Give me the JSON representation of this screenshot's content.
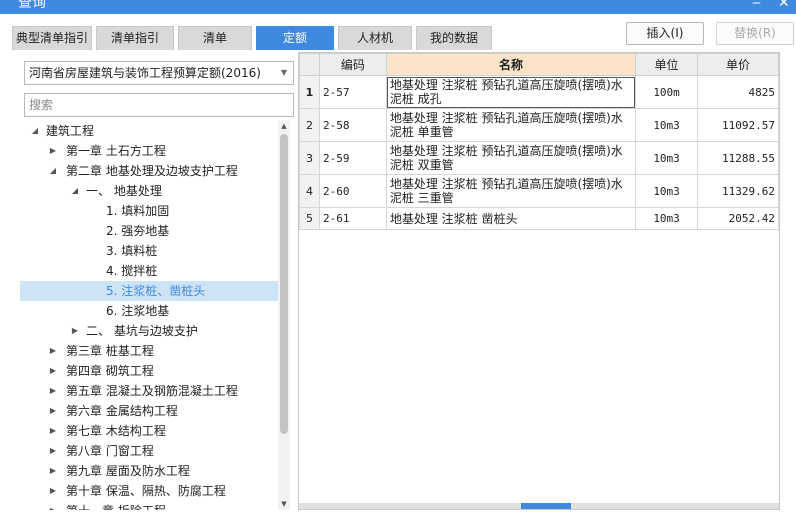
{
  "window": {
    "title": "查询",
    "min_glyph": "‒",
    "close_glyph": "✕"
  },
  "tabs": [
    {
      "label": "典型清单指引",
      "active": false
    },
    {
      "label": "清单指引",
      "active": false
    },
    {
      "label": "清单",
      "active": false
    },
    {
      "label": "定额",
      "active": true
    },
    {
      "label": "人材机",
      "active": false
    },
    {
      "label": "我的数据",
      "active": false
    }
  ],
  "toolbar": {
    "insert_label": "插入(I)",
    "replace_label": "替换(R)"
  },
  "left": {
    "library": "河南省房屋建筑与装饰工程预算定额(2016)",
    "search_placeholder": "搜索"
  },
  "tree": [
    {
      "label": "建筑工程",
      "level": 0,
      "toggle": "◢",
      "selected": false
    },
    {
      "label": "第一章 土石方工程",
      "level": 1,
      "toggle": "▶",
      "selected": false
    },
    {
      "label": "第二章 地基处理及边坡支护工程",
      "level": 1,
      "toggle": "◢",
      "selected": false
    },
    {
      "label": "一、 地基处理",
      "level": 2,
      "toggle": "◢",
      "selected": false
    },
    {
      "label": "1. 填料加固",
      "level": 3,
      "toggle": "",
      "selected": false
    },
    {
      "label": "2. 强夯地基",
      "level": 3,
      "toggle": "",
      "selected": false
    },
    {
      "label": "3. 填料桩",
      "level": 3,
      "toggle": "",
      "selected": false
    },
    {
      "label": "4. 搅拌桩",
      "level": 3,
      "toggle": "",
      "selected": false
    },
    {
      "label": "5. 注浆桩、凿桩头",
      "level": 3,
      "toggle": "",
      "selected": true
    },
    {
      "label": "6. 注浆地基",
      "level": 3,
      "toggle": "",
      "selected": false
    },
    {
      "label": "二、 基坑与边坡支护",
      "level": 2,
      "toggle": "▶",
      "selected": false
    },
    {
      "label": "第三章 桩基工程",
      "level": 1,
      "toggle": "▶",
      "selected": false
    },
    {
      "label": "第四章 砌筑工程",
      "level": 1,
      "toggle": "▶",
      "selected": false
    },
    {
      "label": "第五章 混凝土及钢筋混凝土工程",
      "level": 1,
      "toggle": "▶",
      "selected": false
    },
    {
      "label": "第六章 金属结构工程",
      "level": 1,
      "toggle": "▶",
      "selected": false
    },
    {
      "label": "第七章 木结构工程",
      "level": 1,
      "toggle": "▶",
      "selected": false
    },
    {
      "label": "第八章 门窗工程",
      "level": 1,
      "toggle": "▶",
      "selected": false
    },
    {
      "label": "第九章 屋面及防水工程",
      "level": 1,
      "toggle": "▶",
      "selected": false
    },
    {
      "label": "第十章 保温、隔热、防腐工程",
      "level": 1,
      "toggle": "▶",
      "selected": false
    },
    {
      "label": "第十一章 拆除工程",
      "level": 1,
      "toggle": "▶",
      "selected": false
    }
  ],
  "table": {
    "columns": [
      "编码",
      "名称",
      "单位",
      "单价"
    ],
    "rows": [
      {
        "idx": "1",
        "code": "2-57",
        "name": "地基处理 注浆桩 预钻孔道高压旋喷(摆喷)水泥桩 成孔",
        "unit": "100m",
        "price": "4825"
      },
      {
        "idx": "2",
        "code": "2-58",
        "name": "地基处理 注浆桩 预钻孔道高压旋喷(摆喷)水泥桩 单重管",
        "unit": "10m3",
        "price": "11092.57"
      },
      {
        "idx": "3",
        "code": "2-59",
        "name": "地基处理 注浆桩 预钻孔道高压旋喷(摆喷)水泥桩 双重管",
        "unit": "10m3",
        "price": "11288.55"
      },
      {
        "idx": "4",
        "code": "2-60",
        "name": "地基处理 注浆桩 预钻孔道高压旋喷(摆喷)水泥桩 三重管",
        "unit": "10m3",
        "price": "11329.62"
      },
      {
        "idx": "5",
        "code": "2-61",
        "name": "地基处理 注浆桩 凿桩头",
        "unit": "10m3",
        "price": "2052.42"
      }
    ]
  },
  "colors": {
    "accent": "#3f8ae0",
    "header_highlight": "#fbe4c8",
    "selected_row": "#cde4f7"
  }
}
